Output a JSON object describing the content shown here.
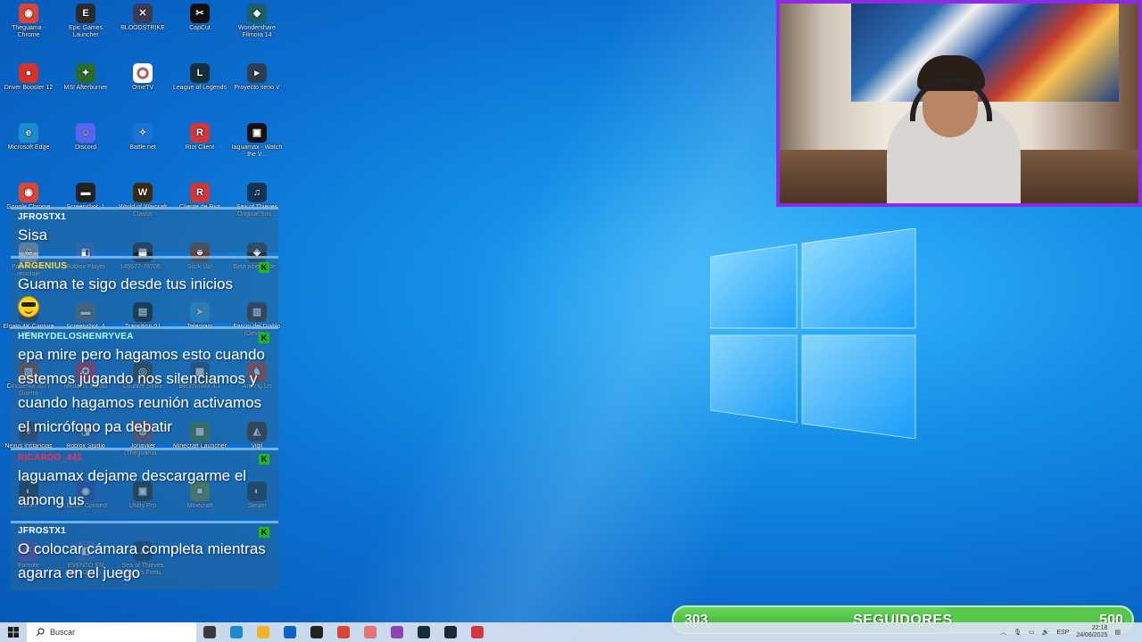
{
  "desktop_icons": [
    {
      "label": "Theguama - Chrome",
      "color": "#db4437",
      "glyph": "◉"
    },
    {
      "label": "Epic Games Launcher",
      "color": "#2a2a2a",
      "glyph": "E"
    },
    {
      "label": "BLOODSTRIKE",
      "color": "#3a3a55",
      "glyph": "✕"
    },
    {
      "label": "CapCut",
      "color": "#111111",
      "glyph": "✂"
    },
    {
      "label": "Wondershare Filmora 14",
      "color": "#1a5f6a",
      "glyph": "◆"
    },
    {
      "label": "Driver Booster 12",
      "color": "#d8302a",
      "glyph": "●"
    },
    {
      "label": "MSI Afterburner",
      "color": "#2a6a2a",
      "glyph": "✦"
    },
    {
      "label": "OmeTV",
      "color": "#ffffff",
      "glyph": "◯"
    },
    {
      "label": "League of Legends",
      "color": "#15303a",
      "glyph": "L"
    },
    {
      "label": "Proyecto serio V",
      "color": "#2c3e50",
      "glyph": "▸"
    },
    {
      "label": "Microsoft Edge",
      "color": "#1a8bd0",
      "glyph": "e"
    },
    {
      "label": "Discord",
      "color": "#5865f2",
      "glyph": "☺"
    },
    {
      "label": "Battle.net",
      "color": "#1a74d8",
      "glyph": "✧"
    },
    {
      "label": "Riot Client",
      "color": "#d13639",
      "glyph": "R"
    },
    {
      "label": "Iaguamax - Watch the V...",
      "color": "#111111",
      "glyph": "▣"
    },
    {
      "label": "Google Chrome",
      "color": "#db4437",
      "glyph": "◉"
    },
    {
      "label": "Screenshot_1",
      "color": "#222222",
      "glyph": "▬"
    },
    {
      "label": "World of Warcraft Classic",
      "color": "#3a2a10",
      "glyph": "W"
    },
    {
      "label": "Cliente de Riot",
      "color": "#d13639",
      "glyph": "R"
    },
    {
      "label": "Sea of Thieves Original Sou...",
      "color": "#123456",
      "glyph": "♫"
    },
    {
      "label": "Papelera de reciclaje",
      "color": "#9aa5b0",
      "glyph": "♲"
    },
    {
      "label": "Roblox Player",
      "color": "#3366cc",
      "glyph": "◧"
    },
    {
      "label": "145577-78705...",
      "color": "#222222",
      "glyph": "▦"
    },
    {
      "label": "Suck Up!",
      "color": "#7a3a1a",
      "glyph": "☻"
    },
    {
      "label": "Beta abierta de...",
      "color": "#333333",
      "glyph": "◈"
    },
    {
      "label": "Elgato 4K Capture Utility",
      "color": "#223344",
      "glyph": "◐"
    },
    {
      "label": "Screenshot_4",
      "color": "#666666",
      "glyph": "▬"
    },
    {
      "label": "Transition 01",
      "color": "#111111",
      "glyph": "▤"
    },
    {
      "label": "Telegram",
      "color": "#2aa1da",
      "glyph": "➤"
    },
    {
      "label": "Farcry del Diablo (Devil's...",
      "color": "#442222",
      "glyph": "▥"
    },
    {
      "label": "Cincuenta 3077 Guerra",
      "color": "#884422",
      "glyph": "▨"
    },
    {
      "label": "Medal.tv Studio",
      "color": "#cc2244",
      "glyph": "✪"
    },
    {
      "label": "Counter-Strike",
      "color": "#333333",
      "glyph": "◎"
    },
    {
      "label": "Benchmark 4.1",
      "color": "#224466",
      "glyph": "▩"
    },
    {
      "label": "Among Us",
      "color": "#c0392b",
      "glyph": "♞"
    },
    {
      "label": "Nexus Instancias",
      "color": "#333355",
      "glyph": "◊"
    },
    {
      "label": "Roblox Studio",
      "color": "#2255aa",
      "glyph": "◨"
    },
    {
      "label": "Jonayker (Theguama...",
      "color": "#884455",
      "glyph": "◍"
    },
    {
      "label": "Minecraft Launcher",
      "color": "#4a7a2a",
      "glyph": "▦"
    },
    {
      "label": "Vigil",
      "color": "#442211",
      "glyph": "◭"
    },
    {
      "label": "Steam",
      "color": "#1b2838",
      "glyph": "◐"
    },
    {
      "label": "Ubisoft Connect",
      "color": "#2244aa",
      "glyph": "◉"
    },
    {
      "label": "Utility Pro",
      "color": "#222222",
      "glyph": "▣"
    },
    {
      "label": "Minecraft",
      "color": "#6a8a3a",
      "glyph": "■"
    },
    {
      "label": "Steam",
      "color": "#1b2838",
      "glyph": "◐"
    },
    {
      "label": "Fortnite",
      "color": "#6644aa",
      "glyph": "F"
    },
    {
      "label": "EVENTO EN ROBLOX (1)...",
      "color": "#3366cc",
      "glyph": "◧"
    },
    {
      "label": "Sea of Thieves Athena's Fortu...",
      "color": "#123456",
      "glyph": "♫"
    }
  ],
  "chat": [
    {
      "user": "JFROSTX1",
      "user_color": "#ffffff",
      "text": "Sisa",
      "badge": ""
    },
    {
      "user": "ARGENIUS",
      "user_color": "#ffd23f",
      "text": "Guama te sigo desde tus inicios",
      "badge": "K",
      "emote": true
    },
    {
      "user": "HENRYDELOSHENRYVEA",
      "user_color": "#a8ffef",
      "text": "epa mire pero hagamos esto cuando estemos jugando nos silenciamos y cuando hagamos reunión activamos el micrófono pa debatir",
      "badge": "K"
    },
    {
      "user": "RICARDO_441",
      "user_color": "#ff2a55",
      "text": "laguamax dejame descargarme el among us",
      "badge": "K"
    },
    {
      "user": "JFROSTX1",
      "user_color": "#ffffff",
      "text": "O colocar cámara completa mientras agarra en el juego",
      "badge": "K"
    }
  ],
  "goal": {
    "current": "303",
    "label": "SEGUIDORES",
    "target": "500",
    "progress": 0.606
  },
  "taskbar": {
    "search_placeholder": "Buscar",
    "apps": [
      {
        "name": "task-view-icon",
        "color": "#3a3a3a"
      },
      {
        "name": "edge-icon",
        "color": "#1a8bd0"
      },
      {
        "name": "file-explorer-icon",
        "color": "#f0b429"
      },
      {
        "name": "outlook-icon",
        "color": "#0a64c8"
      },
      {
        "name": "obs-icon",
        "color": "#222222"
      },
      {
        "name": "chrome-icon",
        "color": "#db4437"
      },
      {
        "name": "mail-icon",
        "color": "#e57373"
      },
      {
        "name": "colorful-app-icon",
        "color": "#8e44ad"
      },
      {
        "name": "league-icon",
        "color": "#15303a"
      },
      {
        "name": "steam-icon",
        "color": "#1b2838"
      },
      {
        "name": "riot-icon",
        "color": "#d13639"
      }
    ],
    "lang": "ESP",
    "time": "22:18",
    "date": "24/06/2025"
  }
}
